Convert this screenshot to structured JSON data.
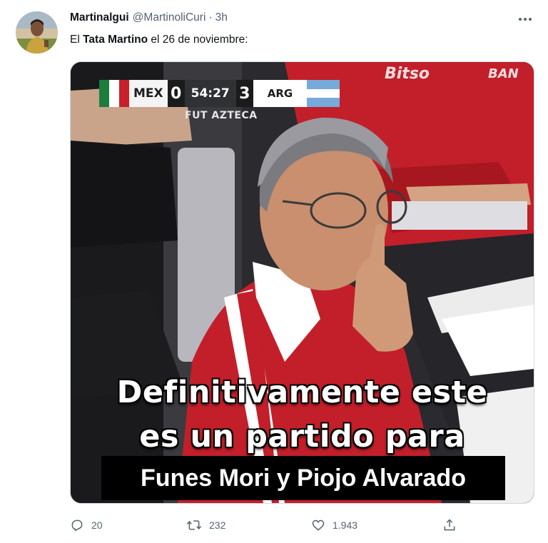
{
  "tweet": {
    "author": {
      "display_name": "Martinalgui",
      "handle": "@MartinoliCuri",
      "separator": "·",
      "time": "3h"
    },
    "text": {
      "prefix": "El ",
      "bold": "Tata Martino",
      "suffix": " el 26 de noviembre:"
    }
  },
  "media": {
    "scorebug": {
      "home_team": "MEX",
      "home_score": "0",
      "clock": "54:27",
      "away_score": "3",
      "away_team": "ARG",
      "network": "FUT AZTECA"
    },
    "background_text": {
      "sponsor_1": "Bitso",
      "sponsor_2": "BAN"
    },
    "caption": {
      "line1": "Definitivamente este",
      "line2": "es un partido para",
      "line3": "Funes Mori y Piojo Alvarado"
    }
  },
  "actions": {
    "reply_count": "20",
    "retweet_count": "232",
    "like_count": "1.943"
  },
  "colors": {
    "text_primary": "#0f1419",
    "text_secondary": "#536471",
    "border": "#cfd9de",
    "mexico_green": "#1c7d3c",
    "mexico_red": "#c8202b",
    "argentina_blue": "#75aadb",
    "jersey_red": "#c21f2a"
  },
  "icons": {
    "more": "more-horizontal-icon",
    "reply": "reply-icon",
    "retweet": "retweet-icon",
    "like": "heart-icon",
    "share": "share-icon"
  }
}
